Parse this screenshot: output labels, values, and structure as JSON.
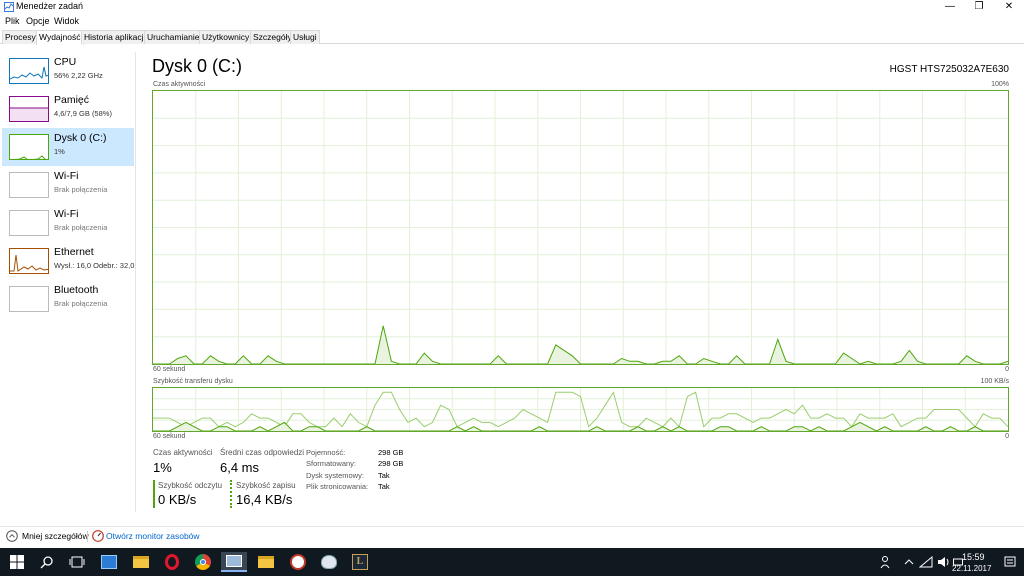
{
  "window": {
    "title": "Menedżer zadań",
    "minimize": "—",
    "maximize": "❐",
    "close": "✕"
  },
  "menu": [
    "Plik",
    "Opcje",
    "Widok"
  ],
  "tabs": [
    "Procesy",
    "Wydajność",
    "Historia aplikacji",
    "Uruchamianie",
    "Użytkownicy",
    "Szczegóły",
    "Usługi"
  ],
  "active_tab": "Wydajność",
  "sidebar": [
    {
      "name": "CPU",
      "sub": "56% 2,22 GHz",
      "color": "#1177bb"
    },
    {
      "name": "Pamięć",
      "sub": "4,6/7,9 GB (58%)",
      "color": "#8b0a8b"
    },
    {
      "name": "Dysk 0 (C:)",
      "sub": "1%",
      "color": "#4da60c"
    },
    {
      "name": "Wi-Fi",
      "sub": "Brak połączenia",
      "color": "#bbbbbb"
    },
    {
      "name": "Wi-Fi",
      "sub": "Brak połączenia",
      "color": "#bbbbbb"
    },
    {
      "name": "Ethernet",
      "sub": "Wysł.: 16,0 Odebr.: 32,0",
      "color": "#a74f01"
    },
    {
      "name": "Bluetooth",
      "sub": "Brak połączenia",
      "color": "#bbbbbb"
    }
  ],
  "main": {
    "title": "Dysk 0 (C:)",
    "model": "HGST HTS725032A7E630",
    "graph1": {
      "label": "Czas aktywności",
      "max": "100%",
      "time": "60 sekund",
      "min": "0",
      "series": [
        0,
        0,
        0,
        2,
        3,
        0,
        0,
        3,
        1,
        0,
        0,
        3,
        0,
        0,
        3,
        1,
        0,
        0,
        0,
        0,
        0,
        0,
        0,
        0,
        0,
        0,
        0,
        0,
        14,
        1,
        0,
        0,
        0,
        4,
        1,
        0,
        0,
        0,
        0,
        0,
        0,
        0,
        3,
        0,
        0,
        0,
        0,
        0,
        0,
        7,
        5,
        3,
        0,
        0,
        0,
        0,
        0,
        2,
        1,
        1,
        0,
        0,
        1,
        1,
        3,
        0,
        0,
        2,
        1,
        0,
        0,
        3,
        0,
        0,
        0,
        0,
        9,
        1,
        0,
        0,
        0,
        0,
        0,
        0,
        4,
        2,
        0,
        1,
        0,
        0,
        0,
        1,
        5,
        1,
        0,
        0,
        0,
        0,
        0,
        3,
        1,
        0,
        0,
        0,
        1
      ]
    },
    "graph2": {
      "label": "Szybkość transferu dysku",
      "max": "100 KB/s",
      "time": "60 sekund",
      "min": "0",
      "series1": [
        3,
        3,
        3,
        2,
        1,
        2,
        3,
        3,
        1,
        2,
        1,
        2,
        4,
        3,
        3,
        2,
        1,
        4,
        4,
        2,
        1,
        1,
        3,
        1,
        4,
        2,
        1,
        6,
        9,
        9,
        5,
        2,
        3,
        1,
        2,
        6,
        5,
        1,
        2,
        3,
        2,
        2,
        1,
        2,
        3,
        5,
        4,
        3,
        2,
        9,
        9,
        9,
        8,
        1,
        3,
        6,
        9,
        2,
        1,
        1,
        3,
        2,
        1,
        3,
        1,
        8,
        9,
        1,
        3,
        3,
        4,
        4,
        3,
        2,
        3,
        3,
        4,
        5,
        4,
        6,
        3,
        3,
        4,
        3,
        3,
        1,
        4,
        3,
        3,
        3,
        4,
        1,
        2,
        3,
        3,
        5,
        5,
        5,
        5,
        3,
        1,
        4,
        3,
        3,
        1
      ],
      "series2": [
        0,
        0,
        0,
        1,
        2,
        1,
        0,
        0,
        1,
        1,
        0,
        0,
        0,
        1,
        0,
        1,
        2,
        0,
        0,
        1,
        1,
        0,
        0,
        0,
        0,
        0,
        1,
        0,
        0,
        0,
        0,
        0,
        0,
        0,
        0,
        0,
        0,
        1,
        0,
        1,
        0,
        0,
        0,
        0,
        0,
        0,
        0,
        1,
        0,
        0,
        0,
        0,
        0,
        0,
        1,
        0,
        0,
        0,
        0,
        1,
        0,
        0,
        1,
        0,
        1,
        0,
        0,
        0,
        0,
        1,
        1,
        0,
        0,
        0,
        1,
        0,
        0,
        0,
        1,
        1,
        0,
        1,
        0,
        0,
        0,
        1,
        2,
        1,
        0,
        1,
        0,
        0,
        0,
        0,
        1,
        0,
        0,
        1,
        0,
        0,
        1,
        0,
        0,
        0,
        0
      ]
    },
    "stats": {
      "active_label": "Czas aktywności",
      "active_value": "1%",
      "resp_label": "Średni czas odpowiedzi",
      "resp_value": "6,4 ms",
      "read_label": "Szybkość odczytu",
      "read_value": "0 KB/s",
      "write_label": "Szybkość zapisu",
      "write_value": "16,4 KB/s"
    },
    "props": [
      {
        "k": "Pojemność:",
        "v": "298 GB"
      },
      {
        "k": "Sformatowany:",
        "v": "298 GB"
      },
      {
        "k": "Dysk systemowy:",
        "v": "Tak"
      },
      {
        "k": "Plik stronicowania:",
        "v": "Tak"
      }
    ]
  },
  "footer": {
    "less": "Mniej szczegółów",
    "link": "Otwórz monitor zasobów"
  },
  "taskbar": {
    "time": "15:59",
    "date": "22.11.2017"
  }
}
